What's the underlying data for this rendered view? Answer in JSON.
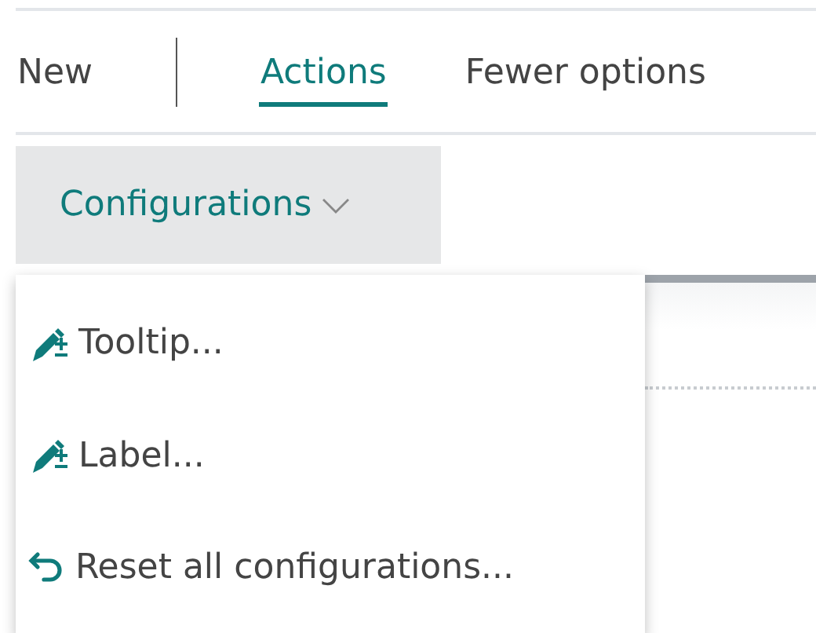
{
  "action_bar": {
    "items": [
      {
        "label": "New",
        "selected": false,
        "divider_after": true
      },
      {
        "label": "Actions",
        "selected": true,
        "divider_after": false
      },
      {
        "label": "Fewer options",
        "selected": false,
        "divider_after": false
      }
    ]
  },
  "menu_button": {
    "label": "Configurations",
    "expanded": true
  },
  "menu": {
    "items": [
      {
        "label": "Tooltip...",
        "kind": "edit"
      },
      {
        "label": "Label...",
        "kind": "edit"
      },
      {
        "label": "Reset all configurations...",
        "kind": "reset"
      }
    ]
  }
}
